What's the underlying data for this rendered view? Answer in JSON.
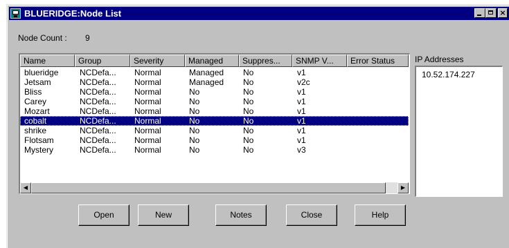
{
  "window": {
    "title": "BLUERIDGE:Node List"
  },
  "node_count": {
    "label": "Node Count :",
    "value": "9"
  },
  "table": {
    "columns": [
      "Name",
      "Group",
      "Severity",
      "Managed",
      "Suppres...",
      "SNMP V...",
      "Error Status"
    ],
    "rows": [
      [
        "blueridge",
        "NCDefa...",
        "Normal",
        "Managed",
        "No",
        "v1",
        ""
      ],
      [
        "Jetsam",
        "NCDefa...",
        "Normal",
        "Managed",
        "No",
        "v2c",
        ""
      ],
      [
        "Bliss",
        "NCDefa...",
        "Normal",
        "No",
        "No",
        "v1",
        ""
      ],
      [
        "Carey",
        "NCDefa...",
        "Normal",
        "No",
        "No",
        "v1",
        ""
      ],
      [
        "Mozart",
        "NCDefa...",
        "Normal",
        "No",
        "No",
        "v1",
        ""
      ],
      [
        "cobalt",
        "NCDefa...",
        "Normal",
        "No",
        "No",
        "v1",
        ""
      ],
      [
        "shrike",
        "NCDefa...",
        "Normal",
        "No",
        "No",
        "v1",
        ""
      ],
      [
        "Flotsam",
        "NCDefa...",
        "Normal",
        "No",
        "No",
        "v1",
        ""
      ],
      [
        "Mystery",
        "NCDefa...",
        "Normal",
        "No",
        "No",
        "v3",
        ""
      ]
    ],
    "selected_row_index": 5
  },
  "ip_addresses": {
    "label": "IP Addresses",
    "items": [
      "10.52.174.227"
    ]
  },
  "buttons": {
    "open": "Open",
    "new": "New",
    "notes": "Notes",
    "close": "Close",
    "help": "Help"
  },
  "icons": {
    "app": "node-list-app-icon",
    "minimize": "minimize-icon",
    "maximize": "maximize-icon",
    "close": "close-icon",
    "scroll_left": "arrow-left-icon",
    "scroll_right": "arrow-right-icon"
  },
  "colors": {
    "titlebar": "#000080",
    "selection": "#000080",
    "face": "#c0c0c0"
  }
}
